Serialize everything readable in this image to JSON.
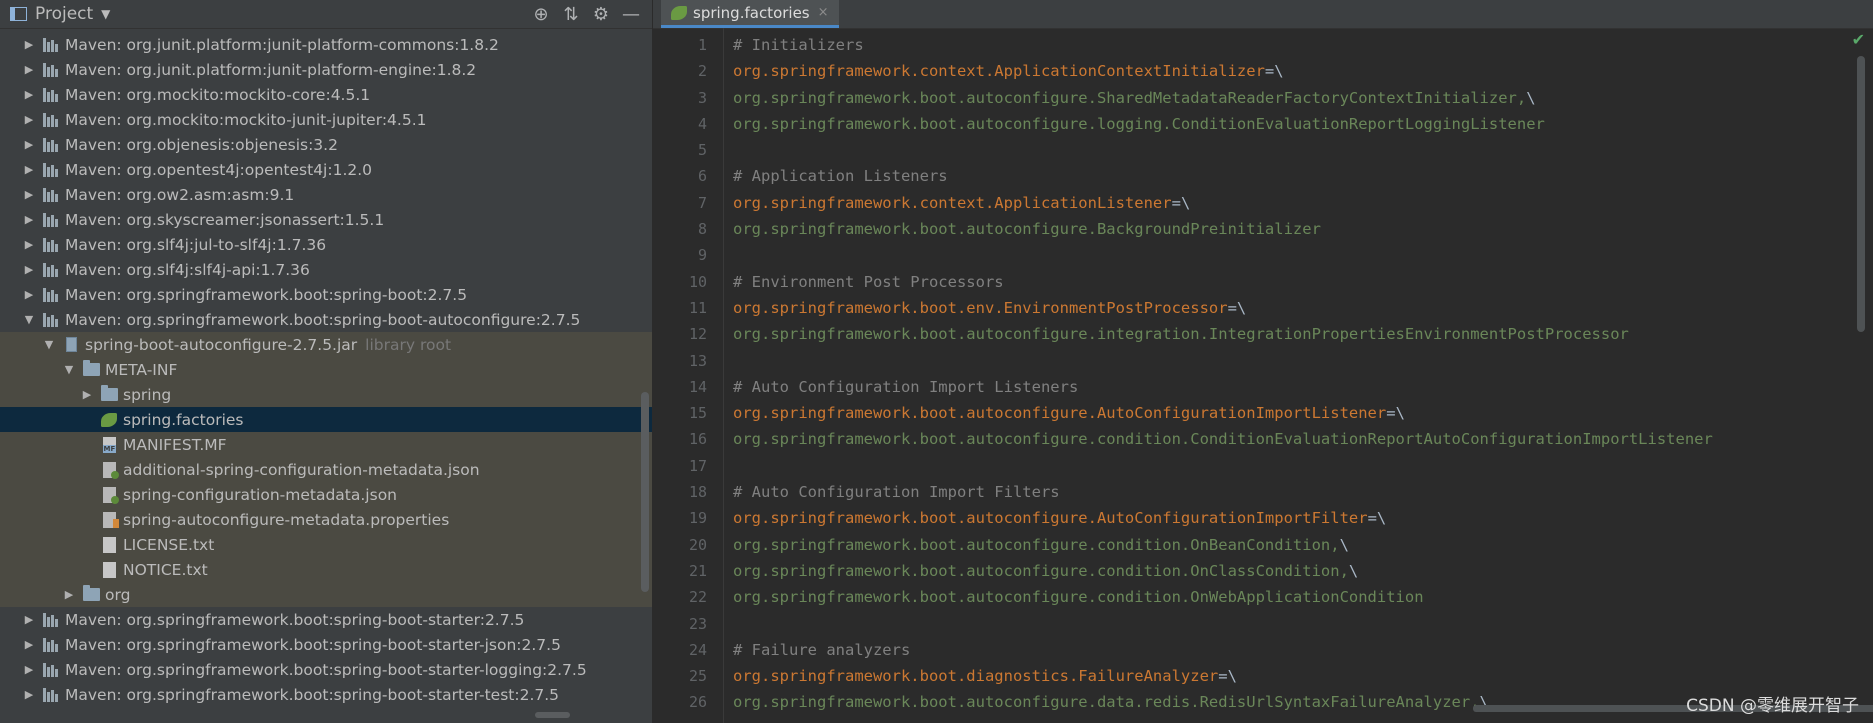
{
  "project_toolbar": {
    "title": "Project",
    "caret": "▼",
    "icons": {
      "locate": "⊕",
      "collapse": "⇅",
      "settings": "⚙",
      "hide": "—"
    }
  },
  "tree": [
    {
      "depth": 0,
      "arrow": "▶",
      "icon": "library-icon",
      "label": "Maven: org.junit.platform:junit-platform-commons:1.8.2",
      "style": ""
    },
    {
      "depth": 0,
      "arrow": "▶",
      "icon": "library-icon",
      "label": "Maven: org.junit.platform:junit-platform-engine:1.8.2",
      "style": ""
    },
    {
      "depth": 0,
      "arrow": "▶",
      "icon": "library-icon",
      "label": "Maven: org.mockito:mockito-core:4.5.1",
      "style": ""
    },
    {
      "depth": 0,
      "arrow": "▶",
      "icon": "library-icon",
      "label": "Maven: org.mockito:mockito-junit-jupiter:4.5.1",
      "style": ""
    },
    {
      "depth": 0,
      "arrow": "▶",
      "icon": "library-icon",
      "label": "Maven: org.objenesis:objenesis:3.2",
      "style": ""
    },
    {
      "depth": 0,
      "arrow": "▶",
      "icon": "library-icon",
      "label": "Maven: org.opentest4j:opentest4j:1.2.0",
      "style": ""
    },
    {
      "depth": 0,
      "arrow": "▶",
      "icon": "library-icon",
      "label": "Maven: org.ow2.asm:asm:9.1",
      "style": ""
    },
    {
      "depth": 0,
      "arrow": "▶",
      "icon": "library-icon",
      "label": "Maven: org.skyscreamer:jsonassert:1.5.1",
      "style": ""
    },
    {
      "depth": 0,
      "arrow": "▶",
      "icon": "library-icon",
      "label": "Maven: org.slf4j:jul-to-slf4j:1.7.36",
      "style": ""
    },
    {
      "depth": 0,
      "arrow": "▶",
      "icon": "library-icon",
      "label": "Maven: org.slf4j:slf4j-api:1.7.36",
      "style": ""
    },
    {
      "depth": 0,
      "arrow": "▶",
      "icon": "library-icon",
      "label": "Maven: org.springframework.boot:spring-boot:2.7.5",
      "style": ""
    },
    {
      "depth": 0,
      "arrow": "▼",
      "icon": "library-icon",
      "label": "Maven: org.springframework.boot:spring-boot-autoconfigure:2.7.5",
      "style": ""
    },
    {
      "depth": 1,
      "arrow": "▼",
      "icon": "jar-icon",
      "label": "spring-boot-autoconfigure-2.7.5.jar",
      "suffix": "library root",
      "style": "dim"
    },
    {
      "depth": 2,
      "arrow": "▼",
      "icon": "folder-icon",
      "label": "META-INF",
      "style": "dim"
    },
    {
      "depth": 3,
      "arrow": "▶",
      "icon": "folder-icon",
      "label": "spring",
      "style": "dim"
    },
    {
      "depth": 3,
      "arrow": "",
      "icon": "spring-factories-icon",
      "label": "spring.factories",
      "style": "sel"
    },
    {
      "depth": 3,
      "arrow": "",
      "icon": "manifest-icon",
      "label": "MANIFEST.MF",
      "style": "dim"
    },
    {
      "depth": 3,
      "arrow": "",
      "icon": "json-icon",
      "label": "additional-spring-configuration-metadata.json",
      "style": "dim"
    },
    {
      "depth": 3,
      "arrow": "",
      "icon": "json-icon",
      "label": "spring-configuration-metadata.json",
      "style": "dim"
    },
    {
      "depth": 3,
      "arrow": "",
      "icon": "properties-icon",
      "label": "spring-autoconfigure-metadata.properties",
      "style": "dim"
    },
    {
      "depth": 3,
      "arrow": "",
      "icon": "text-file-icon",
      "label": "LICENSE.txt",
      "style": "dim"
    },
    {
      "depth": 3,
      "arrow": "",
      "icon": "text-file-icon",
      "label": "NOTICE.txt",
      "style": "dim"
    },
    {
      "depth": 2,
      "arrow": "▶",
      "icon": "folder-icon",
      "label": "org",
      "style": "dim"
    },
    {
      "depth": 0,
      "arrow": "▶",
      "icon": "library-icon",
      "label": "Maven: org.springframework.boot:spring-boot-starter:2.7.5",
      "style": ""
    },
    {
      "depth": 0,
      "arrow": "▶",
      "icon": "library-icon",
      "label": "Maven: org.springframework.boot:spring-boot-starter-json:2.7.5",
      "style": ""
    },
    {
      "depth": 0,
      "arrow": "▶",
      "icon": "library-icon",
      "label": "Maven: org.springframework.boot:spring-boot-starter-logging:2.7.5",
      "style": ""
    },
    {
      "depth": 0,
      "arrow": "▶",
      "icon": "library-icon",
      "label": "Maven: org.springframework.boot:spring-boot-starter-test:2.7.5",
      "style": ""
    }
  ],
  "editor": {
    "tab": {
      "label": "spring.factories",
      "close": "×"
    },
    "status_check": "✔",
    "lines": [
      {
        "n": "1",
        "kind": "comment",
        "text": "# Initializers"
      },
      {
        "n": "2",
        "kind": "key",
        "text": "org.springframework.context.ApplicationContextInitializer",
        "sep": "=\\"
      },
      {
        "n": "3",
        "kind": "val",
        "text": "org.springframework.boot.autoconfigure.SharedMetadataReaderFactoryContextInitializer,",
        "sep": "\\"
      },
      {
        "n": "4",
        "kind": "val",
        "text": "org.springframework.boot.autoconfigure.logging.ConditionEvaluationReportLoggingListener"
      },
      {
        "n": "5",
        "kind": "blank",
        "text": ""
      },
      {
        "n": "6",
        "kind": "comment",
        "text": "# Application Listeners"
      },
      {
        "n": "7",
        "kind": "key",
        "text": "org.springframework.context.ApplicationListener",
        "sep": "=\\"
      },
      {
        "n": "8",
        "kind": "val",
        "text": "org.springframework.boot.autoconfigure.BackgroundPreinitializer"
      },
      {
        "n": "9",
        "kind": "blank",
        "text": ""
      },
      {
        "n": "10",
        "kind": "comment",
        "text": "# Environment Post Processors"
      },
      {
        "n": "11",
        "kind": "key",
        "text": "org.springframework.boot.env.EnvironmentPostProcessor",
        "sep": "=\\"
      },
      {
        "n": "12",
        "kind": "val",
        "text": "org.springframework.boot.autoconfigure.integration.IntegrationPropertiesEnvironmentPostProcessor"
      },
      {
        "n": "13",
        "kind": "blank",
        "text": ""
      },
      {
        "n": "14",
        "kind": "comment",
        "text": "# Auto Configuration Import Listeners"
      },
      {
        "n": "15",
        "kind": "key",
        "text": "org.springframework.boot.autoconfigure.AutoConfigurationImportListener",
        "sep": "=\\"
      },
      {
        "n": "16",
        "kind": "val",
        "text": "org.springframework.boot.autoconfigure.condition.ConditionEvaluationReportAutoConfigurationImportListener"
      },
      {
        "n": "17",
        "kind": "blank",
        "text": ""
      },
      {
        "n": "18",
        "kind": "comment",
        "text": "# Auto Configuration Import Filters"
      },
      {
        "n": "19",
        "kind": "key",
        "text": "org.springframework.boot.autoconfigure.AutoConfigurationImportFilter",
        "sep": "=\\"
      },
      {
        "n": "20",
        "kind": "val",
        "text": "org.springframework.boot.autoconfigure.condition.OnBeanCondition,",
        "sep": "\\"
      },
      {
        "n": "21",
        "kind": "val",
        "text": "org.springframework.boot.autoconfigure.condition.OnClassCondition,",
        "sep": "\\"
      },
      {
        "n": "22",
        "kind": "val",
        "text": "org.springframework.boot.autoconfigure.condition.OnWebApplicationCondition"
      },
      {
        "n": "23",
        "kind": "blank",
        "text": ""
      },
      {
        "n": "24",
        "kind": "comment",
        "text": "# Failure analyzers"
      },
      {
        "n": "25",
        "kind": "key",
        "text": "org.springframework.boot.diagnostics.FailureAnalyzer",
        "sep": "=\\"
      },
      {
        "n": "26",
        "kind": "val",
        "text": "org.springframework.boot.autoconfigure.data.redis.RedisUrlSyntaxFailureAnalyzer,",
        "sep": "\\"
      }
    ]
  },
  "watermark": "CSDN @零维展开智子",
  "colors": {
    "panel_bg": "#3c3f41",
    "editor_bg": "#2b2b2b",
    "selection": "#0d293e",
    "key": "#cc7832",
    "value": "#6a8759",
    "comment": "#808080"
  }
}
